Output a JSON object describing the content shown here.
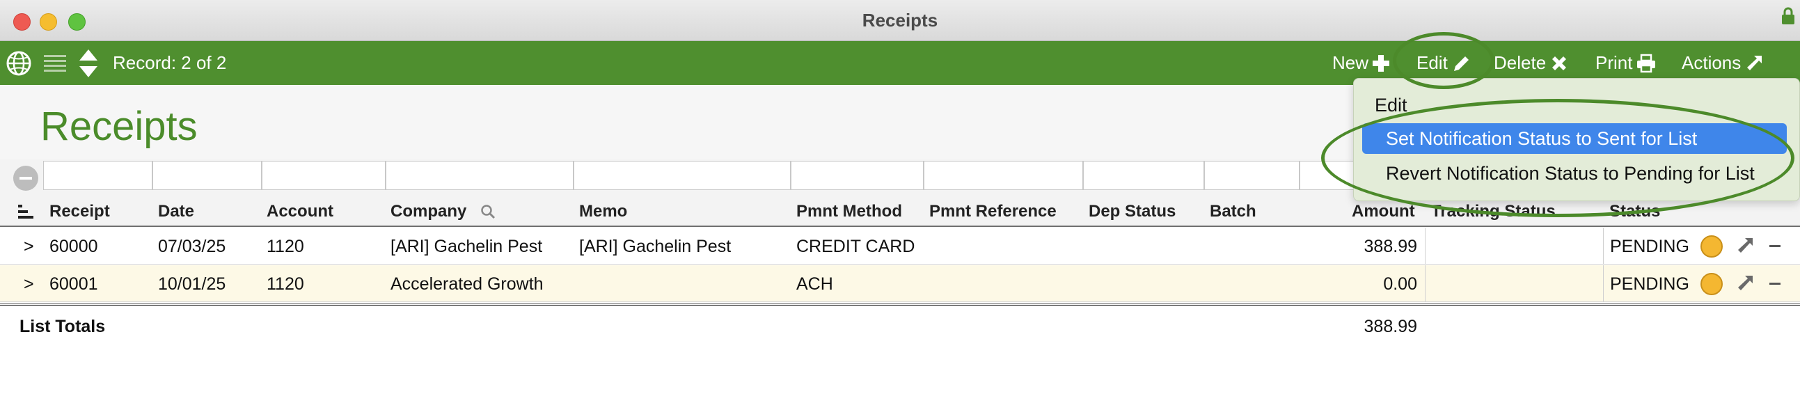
{
  "window": {
    "title": "Receipts"
  },
  "toolbar": {
    "record_label": "Record: 2 of 2",
    "new_label": "New",
    "edit_label": "Edit",
    "delete_label": "Delete",
    "print_label": "Print",
    "actions_label": "Actions"
  },
  "page": {
    "title": "Receipts"
  },
  "columns": {
    "receipt": "Receipt",
    "date": "Date",
    "account": "Account",
    "company": "Company",
    "memo": "Memo",
    "pmnt_method": "Pmnt Method",
    "pmnt_reference": "Pmnt Reference",
    "dep_status": "Dep Status",
    "batch": "Batch",
    "amount": "Amount",
    "tracking_status": "Tracking Status",
    "status": "Status"
  },
  "rows": [
    {
      "expander": ">",
      "receipt": "60000",
      "date": "07/03/25",
      "account": "1120",
      "company": "[ARI] Gachelin Pest",
      "memo": "[ARI] Gachelin Pest",
      "pmnt_method": "CREDIT CARD",
      "pmnt_reference": "",
      "dep_status": "",
      "batch": "",
      "amount": "388.99",
      "tracking_status": "",
      "status": "PENDING"
    },
    {
      "expander": ">",
      "receipt": "60001",
      "date": "10/01/25",
      "account": "1120",
      "company": "Accelerated Growth",
      "memo": "",
      "pmnt_method": "ACH",
      "pmnt_reference": "",
      "dep_status": "",
      "batch": "",
      "amount": "0.00",
      "tracking_status": "",
      "status": "PENDING"
    }
  ],
  "totals": {
    "label": "List Totals",
    "amount": "388.99"
  },
  "dropdown": {
    "items": [
      {
        "label": "Edit",
        "highlighted": false
      },
      {
        "label": "Set Notification Status to Sent for List",
        "highlighted": true
      },
      {
        "label": "Revert Notification Status to Pending for List",
        "highlighted": false
      }
    ]
  },
  "colors": {
    "toolbar_green": "#4f8f2f",
    "title_green": "#4b8c2a",
    "highlight_blue": "#3f86ea",
    "status_dot": "#f4b731",
    "alt_row": "#fdf9e6"
  },
  "icons": {
    "globe": "globe-icon",
    "list": "list-icon",
    "sort": "sort-arrows-icon",
    "new": "plus-icon",
    "edit": "pencil-icon",
    "delete": "x-icon",
    "print": "printer-icon",
    "actions": "arrow-out-icon",
    "lock": "lock-icon",
    "search": "magnifier-icon"
  }
}
